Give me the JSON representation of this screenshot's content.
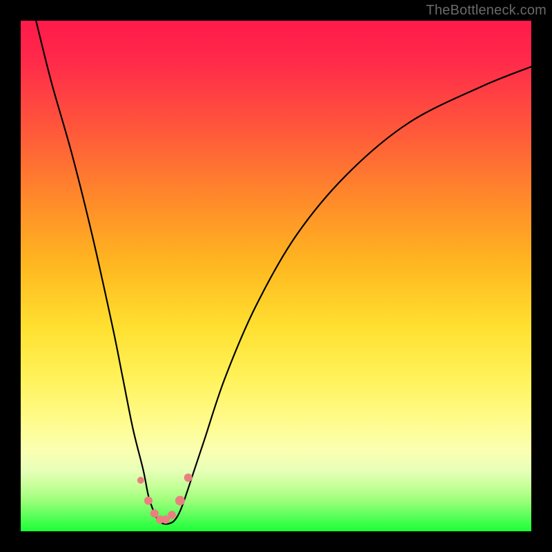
{
  "watermark": "TheBottleneck.com",
  "colors": {
    "frame": "#000000",
    "curve": "#000000",
    "marker_fill": "#e98080",
    "marker_stroke": "#d86a6a"
  },
  "chart_data": {
    "type": "line",
    "title": "",
    "xlabel": "",
    "ylabel": "",
    "xlim": [
      0,
      100
    ],
    "ylim": [
      0,
      100
    ],
    "grid": false,
    "legend": false,
    "series": [
      {
        "name": "bottleneck-curve",
        "comment": "V-shaped bottleneck curve; x is relative position across chart width (0-100), y is bottleneck percent (0 bottom, 100 top). Values estimated from pixels; no axis ticks shown.",
        "x": [
          3,
          6,
          10,
          14,
          18,
          20,
          22,
          24,
          25,
          26,
          27,
          28,
          29,
          30,
          31,
          32,
          34,
          36,
          40,
          46,
          54,
          64,
          76,
          90,
          100
        ],
        "y": [
          100,
          88,
          74,
          58,
          40,
          30,
          20,
          12,
          7,
          4,
          2,
          1.5,
          1.5,
          2,
          3.5,
          6,
          12,
          18,
          30,
          44,
          58,
          70,
          80,
          87,
          91
        ]
      }
    ],
    "markers": {
      "comment": "Pink data points near the valley; same coordinate system as series.",
      "x": [
        23.5,
        25.0,
        26.2,
        27.3,
        28.4,
        29.6,
        31.2,
        32.8
      ],
      "y": [
        10.0,
        6.0,
        3.5,
        2.3,
        2.3,
        3.2,
        6.0,
        10.5
      ],
      "r": [
        5,
        6,
        6,
        6,
        6,
        6,
        7,
        6
      ]
    }
  }
}
